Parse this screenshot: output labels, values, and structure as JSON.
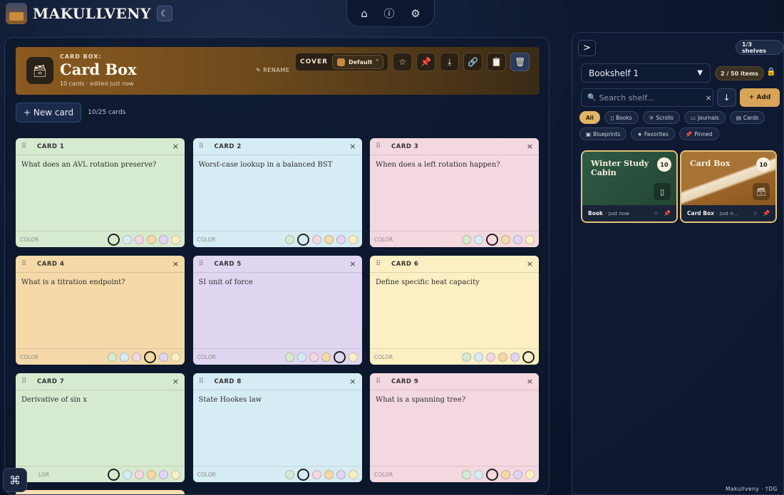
{
  "app": {
    "name": "MAKULLVENY",
    "badge_icon": "moon-icon",
    "footer": "Makullveny · †DG"
  },
  "topnav": [
    {
      "name": "home-icon",
      "glyph": "⌂"
    },
    {
      "name": "info-icon",
      "glyph": "ⓘ"
    },
    {
      "name": "gear-icon",
      "glyph": "⚙"
    }
  ],
  "hero": {
    "kicker": "CARD BOX:",
    "title": "Card Box",
    "subtitle": "10 cards · edited just now",
    "rename": "✎ RENAME",
    "cover_label": "COVER",
    "cover_value": "Default",
    "cover_caret": "˅",
    "cover_color": "#c68a42"
  },
  "toolbar": {
    "new_card": "+ New card",
    "count": "10/25 cards",
    "buttons": [
      {
        "name": "favorite-star-icon",
        "glyph": "☆"
      },
      {
        "name": "pin-icon",
        "glyph": "📌"
      },
      {
        "name": "download-icon",
        "glyph": "⤓"
      },
      {
        "name": "link-icon",
        "glyph": "🔗"
      },
      {
        "name": "clipboard-icon",
        "glyph": "📋"
      },
      {
        "name": "trash-icon",
        "glyph": "🗑"
      }
    ]
  },
  "card_palette": [
    "#d6ead0",
    "#d6ecf5",
    "#f4d8e0",
    "#f5d9a8",
    "#e0d6f2",
    "#fcefc4"
  ],
  "cards": [
    {
      "title": "CARD 1",
      "text": "What does an AVL rotation preserve?",
      "color": 0
    },
    {
      "title": "CARD 2",
      "text": "Worst-case lookup in a balanced BST",
      "color": 1
    },
    {
      "title": "CARD 3",
      "text": "When does a left rotation happen?",
      "color": 2
    },
    {
      "title": "CARD 4",
      "text": "What is a titration endpoint?",
      "color": 3
    },
    {
      "title": "CARD 5",
      "text": "SI unit of force",
      "color": 4
    },
    {
      "title": "CARD 6",
      "text": "Define specific heat capacity",
      "color": 5
    },
    {
      "title": "CARD 7",
      "text": "Derivative of sin x",
      "color": 0
    },
    {
      "title": "CARD 8",
      "text": "State Hookes law",
      "color": 1
    },
    {
      "title": "CARD 9",
      "text": "What is a spanning tree?",
      "color": 2
    }
  ],
  "card_labels": {
    "color": "COLOR",
    "color_partial": "LOR",
    "grip": "⠿",
    "close": "×"
  },
  "command_button": "⌘",
  "sidebar": {
    "collapse": ">",
    "shelves_count": "1/3 shelves",
    "shelf_name": "Bookshelf 1",
    "shelf_caret": "▼",
    "items_count": "2 / 50 items",
    "search_placeholder": "Search shelf...",
    "search_clear": "×",
    "sort_glyph": "↓",
    "add": "+ Add",
    "filters": [
      {
        "label": "All",
        "icon": "",
        "active": true
      },
      {
        "label": "Books",
        "icon": "▯",
        "active": false
      },
      {
        "label": "Scrolls",
        "icon": "⚞",
        "active": false
      },
      {
        "label": "Journals",
        "icon": "▭",
        "active": false
      },
      {
        "label": "Cards",
        "icon": "▤",
        "active": false
      },
      {
        "label": "Blueprints",
        "icon": "▣",
        "active": false
      },
      {
        "label": "Favorites",
        "icon": "★",
        "active": false
      },
      {
        "label": "Pinned",
        "icon": "📌",
        "active": false
      }
    ],
    "books": [
      {
        "title": "Winter Study Cabin",
        "count": "10",
        "kind": "Book",
        "time": "· just now",
        "type_icon": "▯",
        "cover": "linear-gradient(135deg,#2f5a44 0%,#234636 100%)"
      },
      {
        "title": "Card Box",
        "count": "10",
        "kind": "Card Box",
        "time": "· just n...",
        "type_icon": "🗃",
        "cover": "linear-gradient(160deg,#a87436 0%,#a87436 45%,#f1e4cc 48%,#e8d6b6 58%,#9a6428 61%,#8a5820 100%)"
      }
    ],
    "fav_glyph": "☆",
    "pin_glyph": "📌"
  }
}
